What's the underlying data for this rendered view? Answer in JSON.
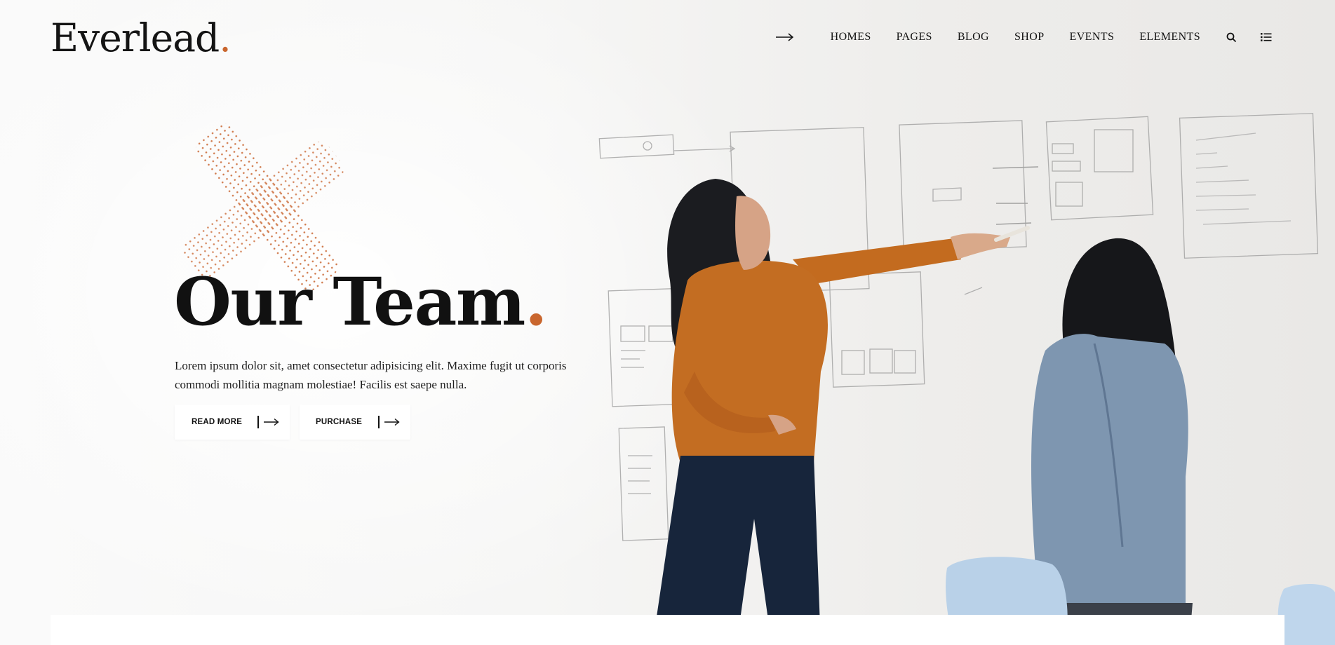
{
  "brand": {
    "name": "Everlead",
    "dot": ".",
    "accent_color": "#c9662e"
  },
  "nav": {
    "arrow_icon": "long-right-arrow-icon",
    "items": [
      {
        "label": "HOMES"
      },
      {
        "label": "PAGES"
      },
      {
        "label": "BLOG"
      },
      {
        "label": "SHOP"
      },
      {
        "label": "EVENTS"
      },
      {
        "label": "ELEMENTS"
      }
    ],
    "icons": [
      "search-icon",
      "list-menu-icon"
    ]
  },
  "hero": {
    "title": "Our Team",
    "title_dot": ".",
    "text": "Lorem ipsum dolor sit, amet consectetur adipisicing elit. Maxime fugit ut corporis commodi mollitia magnam molestiae! Facilis est saepe nulla.",
    "buttons": [
      {
        "label": "READ MORE",
        "icon": "long-right-arrow-icon"
      },
      {
        "label": "PURCHASE",
        "icon": "long-right-arrow-icon"
      }
    ]
  }
}
